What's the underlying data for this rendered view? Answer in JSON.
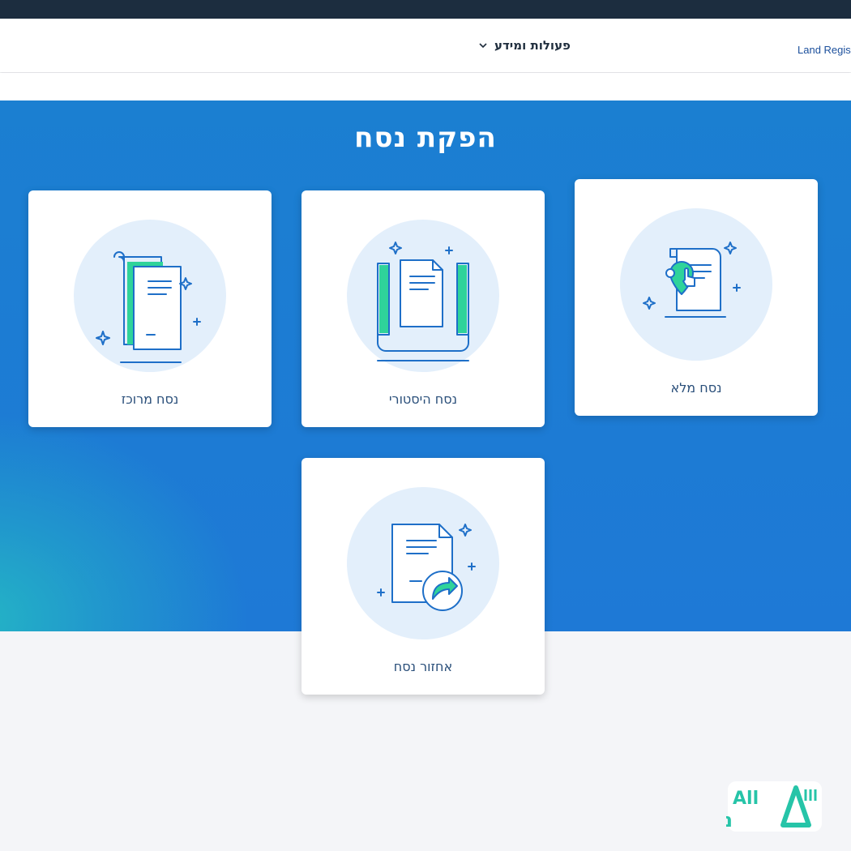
{
  "nav": {
    "menu_label": "פעולות ומידע",
    "brand_label": "Land Regis"
  },
  "page": {
    "title": "הפקת נסח"
  },
  "cards": [
    {
      "label": "נסח מרוכז",
      "icon": "consolidated-document-icon"
    },
    {
      "label": "נסח היסטורי",
      "icon": "historical-scroll-icon"
    },
    {
      "label": "נסח מלא",
      "icon": "full-document-location-icon"
    },
    {
      "label": "אחזור נסח",
      "icon": "retrieve-document-icon"
    }
  ],
  "watermark": {
    "logo_text": "All נדלן"
  },
  "colors": {
    "topbar": "#1c2d3f",
    "hero_blue": "#1e79d6",
    "hero_teal": "#24b8c4",
    "icon_blue": "#1e6fc8",
    "icon_green": "#2fd39a",
    "circle": "#e3effb"
  }
}
